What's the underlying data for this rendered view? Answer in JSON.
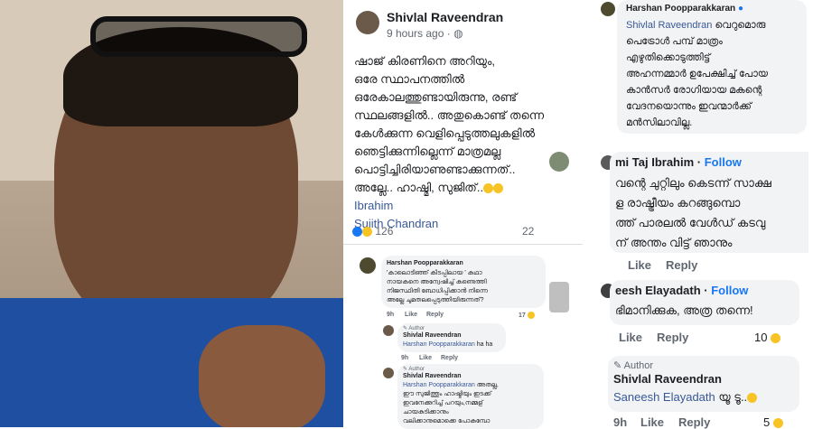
{
  "main_post": {
    "author": "Shivlal Raveendran",
    "time": "9 hours ago",
    "lines": [
      "ഷാജ് കിരണിനെ അറിയും,",
      "ഒരേ സ്ഥാപനത്തിൽ",
      "ഒരേകാലത്തുണ്ടായിരുന്നു, രണ്ട്",
      "സ്ഥലങ്ങളിൽ.. അതുകൊണ്ട് തന്നെ",
      "കേൾക്കുന്ന വെളിപ്പെടുത്തലുകളിൽ",
      "ഞെട്ടിക്കുന്നില്ലെന്ന് മാത്രമല്ല",
      "പൊട്ടിച്ചിരിയാണുണ്ടാക്കുന്നത്..",
      "അല്ലേ.. ഹാഷ്മി, സുജിത്.."
    ],
    "tags": [
      "Ibrahim",
      "Sujith Chandran"
    ],
    "reactions": "126",
    "comments": "22"
  },
  "mid_comments": [
    {
      "author": "Harshan Poopparakkaran",
      "text": [
        "'കാലൊടിഞ്ഞ് കിടപ്പിലായ ' കഥാ",
        "നായകനെ അന്വേഷിച്ച് കണ്ടെത്തി",
        "നിജസ്ഥിതി ബോധിപ്പിക്കാൻ നിന്നെ",
        "അല്ലേ ചുമതലപ്പെടുത്തിയിരുന്നത്?"
      ],
      "time": "9h",
      "like": "Like",
      "reply": "Reply",
      "count": "17"
    },
    {
      "badge": "Author",
      "author": "Shivlal Raveendran",
      "mention": "Harshan Poopparakkaran",
      "text": "ha ha",
      "time": "9h",
      "like": "Like",
      "reply": "Reply"
    },
    {
      "badge": "Author",
      "author": "Shivlal Raveendran",
      "mention": "Harshan Poopparakkaran",
      "text": [
        "അതല്ല,",
        "ഈ സുജിത്തും ഹാഷ്മിയും ഇടക്ക്",
        "ഇവനേക്കുറിച്ച് പറയും,നമ്മള്",
        "ചായകുടിക്കാനും",
        "വലിക്കാനുമൊക്കെ പോകുമ്പോ"
      ]
    }
  ],
  "right_comments": [
    {
      "author": "Harshan Poopparakkaran",
      "mention": "Shivlal Raveendran",
      "text": [
        "വെറുമൊരു",
        "പെട്രോൾ പമ്പ് മാത്രം",
        "എഴുതിക്കൊടുത്തിട്ട്",
        "അഹന്നമ്മാർ ഉപേക്ഷിച്ച് പോയ",
        "കാൻസർ രോഗിയായ മകന്റെ",
        "വേദനയൊന്നും ഇവന്മാർക്ക്",
        "മൻസിലാവില്ല."
      ]
    },
    {
      "author": "mi Taj Ibrahim",
      "follow": "Follow",
      "text": [
        "വന്റെ ചുറ്റിലും കെടന്ന് സാക്ഷ",
        "ള രാഷ്ട്രീയം കറങ്ങുമ്പൊ",
        "ത്ത് പാരലൽ വേൾഡ് കടവു",
        "ന് അന്തം വിട്ട് ഞാനും"
      ],
      "like": "Like",
      "reply": "Reply"
    },
    {
      "author": "eesh Elayadath",
      "follow": "Follow",
      "text": "ഭിമാനിക്കുക, അത്ര തന്നെ!",
      "like": "Like",
      "reply": "Reply",
      "count": "10"
    },
    {
      "badge": "Author",
      "author": "Shivlal Raveendran",
      "mention": "Saneesh Elayadath",
      "text": "യൂ ടൂ..",
      "time": "9h",
      "like": "Like",
      "reply": "Reply",
      "count": "5"
    }
  ]
}
